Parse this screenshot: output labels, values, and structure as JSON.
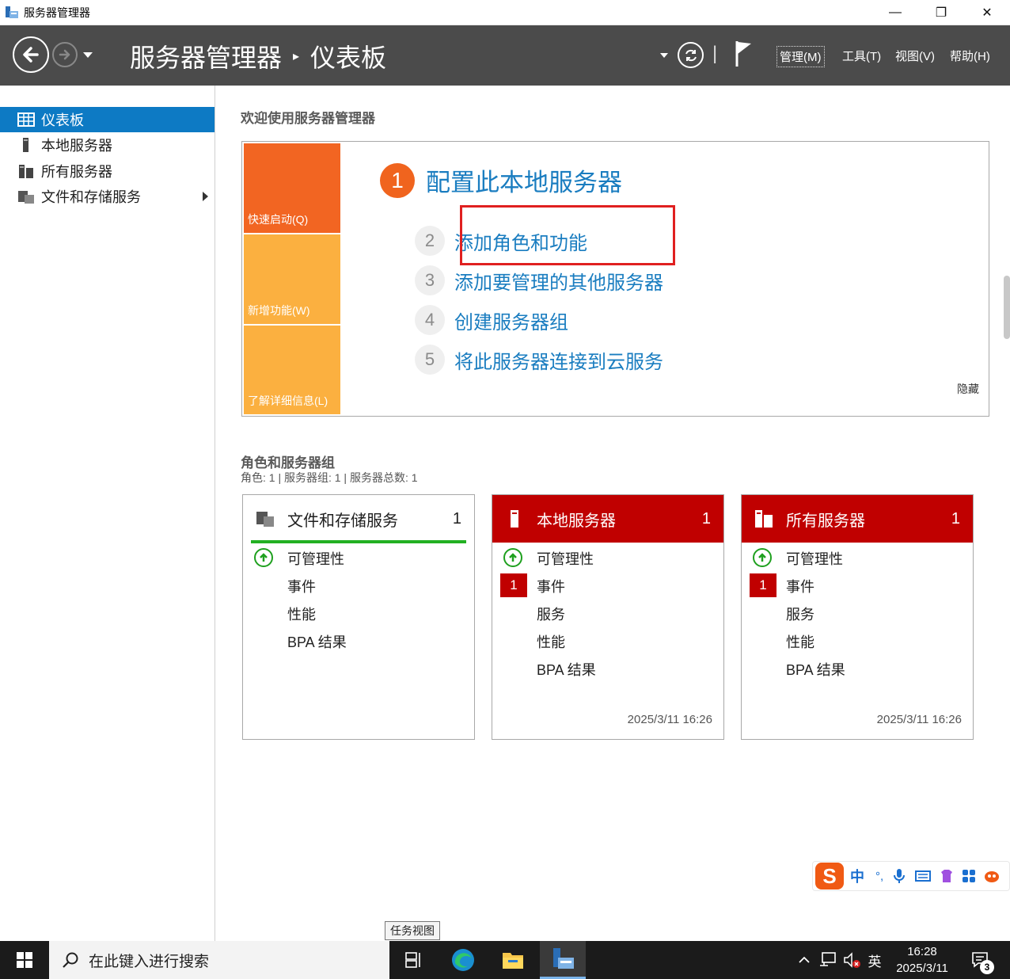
{
  "window": {
    "title": "服务器管理器",
    "min": "—",
    "max": "❐",
    "close": "✕"
  },
  "header": {
    "breadcrumb_root": "服务器管理器",
    "breadcrumb_sep": "▸",
    "breadcrumb_page": "仪表板",
    "divider": "|",
    "menu": {
      "manage": "管理(M)",
      "tools": "工具(T)",
      "view": "视图(V)",
      "help": "帮助(H)"
    }
  },
  "sidebar": {
    "items": [
      {
        "label": "仪表板"
      },
      {
        "label": "本地服务器"
      },
      {
        "label": "所有服务器"
      },
      {
        "label": "文件和存储服务"
      }
    ]
  },
  "welcome": {
    "title": "欢迎使用服务器管理器",
    "tiles": {
      "quick_start": "快速启动(Q)",
      "whats_new": "新增功能(W)",
      "learn_more": "了解详细信息(L)"
    },
    "steps": [
      {
        "num": "1",
        "label": "配置此本地服务器"
      },
      {
        "num": "2",
        "label": "添加角色和功能"
      },
      {
        "num": "3",
        "label": "添加要管理的其他服务器"
      },
      {
        "num": "4",
        "label": "创建服务器组"
      },
      {
        "num": "5",
        "label": "将此服务器连接到云服务"
      }
    ],
    "hide": "隐藏"
  },
  "roles": {
    "title": "角色和服务器组",
    "summary": "角色: 1 | 服务器组: 1 | 服务器总数: 1",
    "cards": [
      {
        "name": "文件和存储服务",
        "count": "1",
        "rows": [
          "可管理性",
          "事件",
          "性能",
          "BPA 结果"
        ]
      },
      {
        "name": "本地服务器",
        "count": "1",
        "rows": [
          "可管理性",
          "事件",
          "服务",
          "性能",
          "BPA 结果"
        ],
        "event_badge": "1",
        "timestamp": "2025/3/11 16:26"
      },
      {
        "name": "所有服务器",
        "count": "1",
        "rows": [
          "可管理性",
          "事件",
          "服务",
          "性能",
          "BPA 结果"
        ],
        "event_badge": "1",
        "timestamp": "2025/3/11 16:26"
      }
    ]
  },
  "ime": {
    "logo": "S",
    "lang": "中",
    "punct": "°,"
  },
  "tooltip": "任务视图",
  "taskbar": {
    "search_placeholder": "在此键入进行搜索",
    "ime_lang": "英",
    "time": "16:28",
    "date": "2025/3/11",
    "notification_count": "3"
  },
  "colors": {
    "header_bg": "#4b4b4b",
    "accent_blue": "#0d7ac4",
    "tile_orange": "#f26522",
    "tile_amber": "#fbb040",
    "card_red": "#c00000",
    "status_green": "#22b022"
  }
}
